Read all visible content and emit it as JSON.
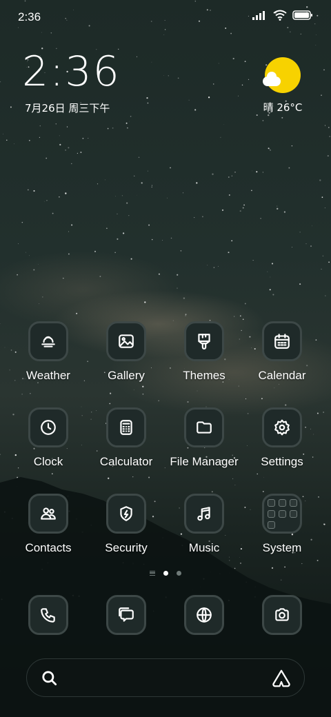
{
  "status_bar": {
    "time": "2:36"
  },
  "clock_widget": {
    "time": "2:36",
    "date": "7月26日 周三下午"
  },
  "weather_widget": {
    "text": "晴 26°C",
    "icon": "sun-cloud-icon"
  },
  "apps": [
    {
      "label": "Weather",
      "icon": "weather-icon"
    },
    {
      "label": "Gallery",
      "icon": "gallery-icon"
    },
    {
      "label": "Themes",
      "icon": "themes-icon"
    },
    {
      "label": "Calendar",
      "icon": "calendar-icon"
    },
    {
      "label": "Clock",
      "icon": "clock-icon"
    },
    {
      "label": "Calculator",
      "icon": "calculator-icon"
    },
    {
      "label": "File Manager",
      "icon": "folder-icon"
    },
    {
      "label": "Settings",
      "icon": "gear-icon"
    },
    {
      "label": "Contacts",
      "icon": "contacts-icon"
    },
    {
      "label": "Security",
      "icon": "shield-icon"
    },
    {
      "label": "Music",
      "icon": "music-note-icon"
    },
    {
      "label": "System",
      "icon": "folder-grid-icon"
    }
  ],
  "page_indicator": {
    "pages": 2,
    "active": 1
  },
  "dock": [
    {
      "icon": "phone-icon"
    },
    {
      "icon": "messages-icon"
    },
    {
      "icon": "browser-globe-icon"
    },
    {
      "icon": "camera-icon"
    }
  ],
  "search_bar": {
    "left_icon": "search-icon",
    "right_icon": "assistant-icon"
  },
  "colors": {
    "sun": "#f7d200",
    "icon_bg": "#1f2a29",
    "icon_border": "#3d4847"
  }
}
